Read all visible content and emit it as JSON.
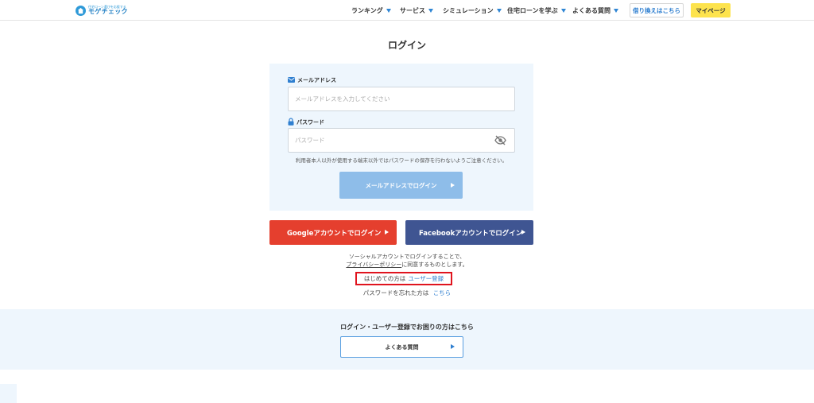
{
  "header": {
    "logo_sub": "住宅ローン選びを応援する",
    "logo_main": "モゲチェック",
    "nav": [
      "ランキング",
      "サービス",
      "シミュレーション",
      "住宅ローンを学ぶ",
      "よくある質問"
    ],
    "refinance_label": "借り換えはこちら",
    "mypage_label": "マイページ"
  },
  "title": "ログイン",
  "form": {
    "email_label": "メールアドレス",
    "email_placeholder": "メールアドレスを入力してください",
    "password_label": "パスワード",
    "password_placeholder": "パスワード",
    "note": "利用者本人以外が使用する端末以外ではパスワードの保存を行わないようご注意ください。",
    "email_login_button": "メールアドレスでログイン"
  },
  "social": {
    "google": "Googleアカウントでログイン",
    "facebook": "Facebookアカウントでログイン",
    "consent_line1": "ソーシャルアカウントでログインすることで、",
    "privacy_link": "プライバシーポリシー",
    "consent_line2": "に同意するものとします。"
  },
  "register": {
    "text": "はじめての方は",
    "link": "ユーザー登録"
  },
  "forgot": {
    "text": "パスワードを忘れた方は",
    "link": "こちら"
  },
  "help": {
    "title": "ログイン・ユーザー登録でお困りの方はこちら",
    "faq_button": "よくある質問"
  },
  "colors": {
    "accent": "#2f7fd0",
    "google": "#e53f2e",
    "facebook": "#3f5592",
    "mypage": "#fde34d",
    "highlight": "#e0141e"
  }
}
